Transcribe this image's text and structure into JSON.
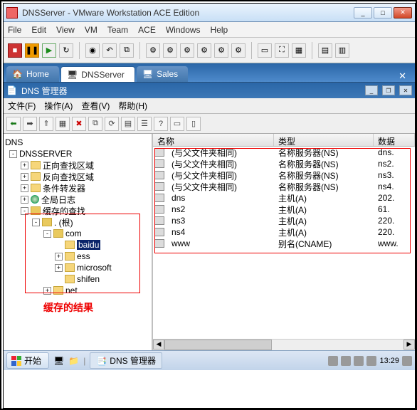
{
  "vmware": {
    "title": "DNSServer - VMware Workstation ACE Edition",
    "menu": [
      "File",
      "Edit",
      "View",
      "VM",
      "Team",
      "ACE",
      "Windows",
      "Help"
    ]
  },
  "tabs": {
    "items": [
      {
        "label": "Home",
        "active": false,
        "icon": "home"
      },
      {
        "label": "DNSServer",
        "active": true,
        "icon": "monitor"
      },
      {
        "label": "Sales",
        "active": false,
        "icon": "monitor"
      }
    ]
  },
  "dns": {
    "title": "DNS 管理器",
    "menu": [
      "文件(F)",
      "操作(A)",
      "查看(V)",
      "帮助(H)"
    ],
    "tree_root": "DNS",
    "server": "DNSSERVER",
    "nodes": {
      "forward": "正向查找区域",
      "reverse": "反向查找区域",
      "cond": "条件转发器",
      "global": "全局日志",
      "cache": "缓存的查找",
      "root": ". (根)",
      "com": "com",
      "baidu": "baidu",
      "ess": "ess",
      "microsoft": "microsoft",
      "shifen": "shifen",
      "net": "net"
    },
    "cache_label": "缓存的结果"
  },
  "list": {
    "cols": {
      "name": "名称",
      "type": "类型",
      "data": "数据"
    },
    "rows": [
      {
        "name": "(与父文件夹相同)",
        "type": "名称服务器(NS)",
        "data": "dns."
      },
      {
        "name": "(与父文件夹相同)",
        "type": "名称服务器(NS)",
        "data": "ns2."
      },
      {
        "name": "(与父文件夹相同)",
        "type": "名称服务器(NS)",
        "data": "ns3."
      },
      {
        "name": "(与父文件夹相同)",
        "type": "名称服务器(NS)",
        "data": "ns4."
      },
      {
        "name": "dns",
        "type": "主机(A)",
        "data": "202."
      },
      {
        "name": "ns2",
        "type": "主机(A)",
        "data": "61."
      },
      {
        "name": "ns3",
        "type": "主机(A)",
        "data": "220."
      },
      {
        "name": "ns4",
        "type": "主机(A)",
        "data": "220."
      },
      {
        "name": "www",
        "type": "别名(CNAME)",
        "data": "www."
      }
    ]
  },
  "taskbar": {
    "start": "开始",
    "app": "DNS 管理器",
    "time": "13:29"
  }
}
